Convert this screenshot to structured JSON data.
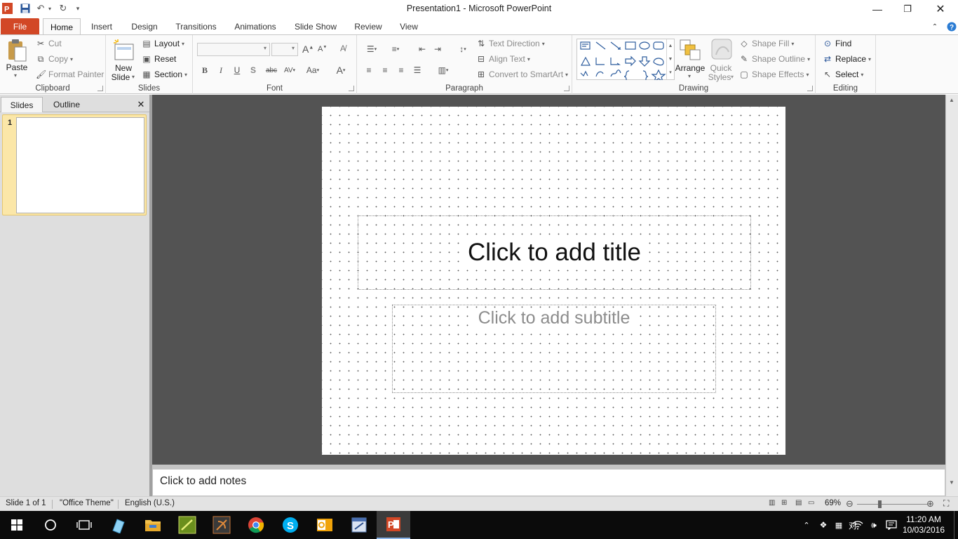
{
  "window": {
    "title": "Presentation1  -  Microsoft PowerPoint",
    "controls": {
      "minimize": "—",
      "restore": "❐",
      "close": "✕"
    }
  },
  "tabs": [
    "File",
    "Home",
    "Insert",
    "Design",
    "Transitions",
    "Animations",
    "Slide Show",
    "Review",
    "View"
  ],
  "active_tab": "Home",
  "ribbon": {
    "clipboard": {
      "label": "Clipboard",
      "paste": "Paste",
      "cut": "Cut",
      "copy": "Copy",
      "format_painter": "Format Painter"
    },
    "slides": {
      "label": "Slides",
      "new_slide_1": "New",
      "new_slide_2": "Slide",
      "layout": "Layout",
      "reset": "Reset",
      "section": "Section"
    },
    "font": {
      "label": "Font",
      "bold": "B",
      "italic": "I",
      "underline": "U",
      "shadow": "S",
      "strike": "abc",
      "spacing": "AV",
      "case": "Aa",
      "grow": "A",
      "shrink": "A",
      "color": "A"
    },
    "paragraph": {
      "label": "Paragraph",
      "text_direction": "Text Direction",
      "align_text": "Align Text",
      "convert_smartart": "Convert to SmartArt"
    },
    "drawing": {
      "label": "Drawing",
      "arrange": "Arrange",
      "quick_styles_1": "Quick",
      "quick_styles_2": "Styles",
      "shape_fill": "Shape Fill",
      "shape_outline": "Shape Outline",
      "shape_effects": "Shape Effects"
    },
    "editing": {
      "label": "Editing",
      "find": "Find",
      "replace": "Replace",
      "select": "Select"
    }
  },
  "left_pane": {
    "tabs": [
      "Slides",
      "Outline"
    ],
    "close": "✕",
    "slide_number": "1"
  },
  "slide": {
    "title_placeholder": "Click to add title",
    "subtitle_placeholder": "Click to add subtitle"
  },
  "notes": {
    "placeholder": "Click to add notes"
  },
  "status_bar": {
    "slide_info": "Slide 1 of 1",
    "theme": "\"Office Theme\"",
    "language": "English (U.S.)",
    "zoom": "69%"
  },
  "taskbar": {
    "time": "11:20 AM",
    "date": "10/03/2016",
    "ime": "对"
  },
  "colors": {
    "file_tab": "#d24726",
    "slide_bg": "#535353",
    "selected_thumb": "#fbe7a8"
  }
}
